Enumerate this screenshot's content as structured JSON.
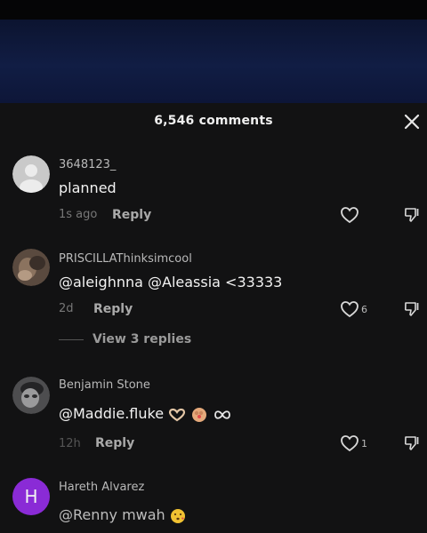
{
  "header": {
    "title": "6,546 comments"
  },
  "icons": {
    "close": "close-icon",
    "like": "heart-icon",
    "dislike": "dislike-icon"
  },
  "colors": {
    "accent_avatar": "#8a2bd6",
    "background": "#121213"
  },
  "comments": [
    {
      "username": "3648123_",
      "text": "planned",
      "time": "1s ago",
      "reply": "Reply",
      "likes": ""
    },
    {
      "username": "PRISCILLAThinksimcool",
      "text": "@aleighnna @Aleassia <33333",
      "time": "2d",
      "reply": "Reply",
      "likes": "6",
      "view_replies": "View 3 replies"
    },
    {
      "username": "Benjamin Stone",
      "text": "@Maddie.fluke",
      "time": "12h",
      "reply": "Reply",
      "likes": "1"
    },
    {
      "username": "Hareth Alvarez",
      "avatar_letter": "H",
      "text": "@Renny mwah"
    }
  ]
}
